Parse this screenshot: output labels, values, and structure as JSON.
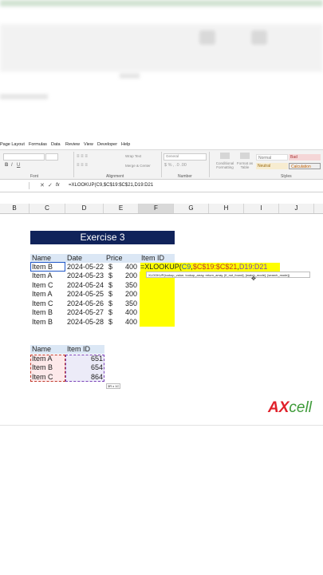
{
  "menu": {
    "items": [
      "Page Layout",
      "Formulas",
      "Data",
      "Review",
      "View",
      "Developer",
      "Help"
    ]
  },
  "ribbon": {
    "groups": {
      "font": "Font",
      "alignment": "Alignment",
      "number": "Number",
      "styles": "Styles"
    },
    "buttons": {
      "wrap_text": "Wrap Text",
      "merge_center": "Merge & Center",
      "number_format": "General",
      "conditional_formatting": "Conditional Formatting",
      "format_as_table": "Format as Table"
    },
    "styles": {
      "normal": "Normal",
      "bad": "Bad",
      "neutral": "Neutral",
      "calculation": "Calculation"
    }
  },
  "formula_bar": {
    "fx": "fx",
    "content": "=XLOOKUP(C9,$C$19:$C$21,D19:D21"
  },
  "columns": [
    "B",
    "C",
    "D",
    "E",
    "F",
    "G",
    "H",
    "I",
    "J"
  ],
  "title": "Exercise 3",
  "table1": {
    "headers": {
      "name": "Name",
      "date": "Date",
      "price": "Price",
      "item_id": "Item ID"
    },
    "currency": "$",
    "rows": [
      {
        "name": "Item B",
        "date": "2024-05-22",
        "price": "400"
      },
      {
        "name": "Item A",
        "date": "2024-05-23",
        "price": "200"
      },
      {
        "name": "Item C",
        "date": "2024-05-24",
        "price": "350"
      },
      {
        "name": "Item A",
        "date": "2024-05-25",
        "price": "200"
      },
      {
        "name": "Item C",
        "date": "2024-05-26",
        "price": "350"
      },
      {
        "name": "Item B",
        "date": "2024-05-27",
        "price": "400"
      },
      {
        "name": "Item B",
        "date": "2024-05-28",
        "price": "400"
      }
    ]
  },
  "editing_formula": {
    "prefix": "=XLOOKUP(",
    "ref1": "C9",
    "sep1": ",",
    "ref2": "$C$19:$C$21",
    "sep2": ",",
    "ref3": "D19:D21"
  },
  "tooltip": "XLOOKUP(lookup_value, lookup_array, return_array, [if_not_found], [match_mode], [search_mode])",
  "table2": {
    "headers": {
      "name": "Name",
      "item_id": "Item ID"
    },
    "rows": [
      {
        "name": "Item A",
        "item_id": "651"
      },
      {
        "name": "Item B",
        "item_id": "654"
      },
      {
        "name": "Item C",
        "item_id": "864"
      }
    ],
    "size_hint": "3R x 1C"
  },
  "logo": {
    "ax": "AX",
    "cell": "cell"
  },
  "colors": {
    "title_bg": "#10235a",
    "header_band": "#dbe7f5",
    "highlight": "#ffff00",
    "logo_red": "#e0202a",
    "logo_green": "#3f9b3a"
  }
}
